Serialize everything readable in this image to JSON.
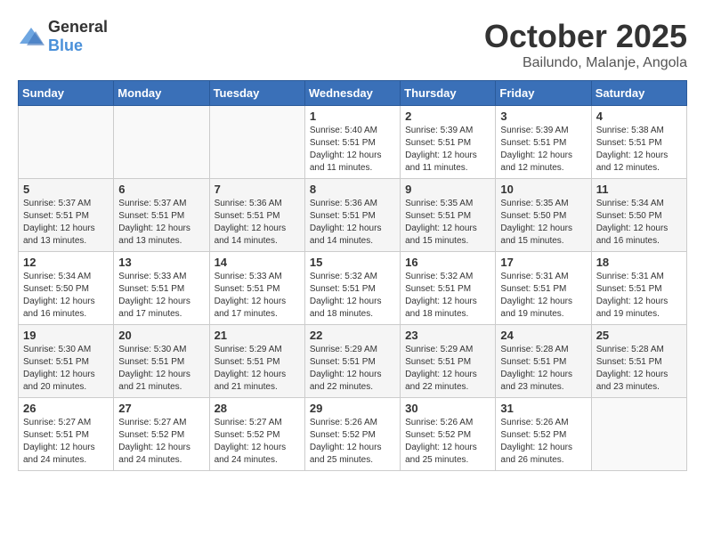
{
  "header": {
    "logo_general": "General",
    "logo_blue": "Blue",
    "title": "October 2025",
    "subtitle": "Bailundo, Malanje, Angola"
  },
  "days_of_week": [
    "Sunday",
    "Monday",
    "Tuesday",
    "Wednesday",
    "Thursday",
    "Friday",
    "Saturday"
  ],
  "weeks": [
    [
      {
        "day": "",
        "info": ""
      },
      {
        "day": "",
        "info": ""
      },
      {
        "day": "",
        "info": ""
      },
      {
        "day": "1",
        "info": "Sunrise: 5:40 AM\nSunset: 5:51 PM\nDaylight: 12 hours and 11 minutes."
      },
      {
        "day": "2",
        "info": "Sunrise: 5:39 AM\nSunset: 5:51 PM\nDaylight: 12 hours and 11 minutes."
      },
      {
        "day": "3",
        "info": "Sunrise: 5:39 AM\nSunset: 5:51 PM\nDaylight: 12 hours and 12 minutes."
      },
      {
        "day": "4",
        "info": "Sunrise: 5:38 AM\nSunset: 5:51 PM\nDaylight: 12 hours and 12 minutes."
      }
    ],
    [
      {
        "day": "5",
        "info": "Sunrise: 5:37 AM\nSunset: 5:51 PM\nDaylight: 12 hours and 13 minutes."
      },
      {
        "day": "6",
        "info": "Sunrise: 5:37 AM\nSunset: 5:51 PM\nDaylight: 12 hours and 13 minutes."
      },
      {
        "day": "7",
        "info": "Sunrise: 5:36 AM\nSunset: 5:51 PM\nDaylight: 12 hours and 14 minutes."
      },
      {
        "day": "8",
        "info": "Sunrise: 5:36 AM\nSunset: 5:51 PM\nDaylight: 12 hours and 14 minutes."
      },
      {
        "day": "9",
        "info": "Sunrise: 5:35 AM\nSunset: 5:51 PM\nDaylight: 12 hours and 15 minutes."
      },
      {
        "day": "10",
        "info": "Sunrise: 5:35 AM\nSunset: 5:50 PM\nDaylight: 12 hours and 15 minutes."
      },
      {
        "day": "11",
        "info": "Sunrise: 5:34 AM\nSunset: 5:50 PM\nDaylight: 12 hours and 16 minutes."
      }
    ],
    [
      {
        "day": "12",
        "info": "Sunrise: 5:34 AM\nSunset: 5:50 PM\nDaylight: 12 hours and 16 minutes."
      },
      {
        "day": "13",
        "info": "Sunrise: 5:33 AM\nSunset: 5:51 PM\nDaylight: 12 hours and 17 minutes."
      },
      {
        "day": "14",
        "info": "Sunrise: 5:33 AM\nSunset: 5:51 PM\nDaylight: 12 hours and 17 minutes."
      },
      {
        "day": "15",
        "info": "Sunrise: 5:32 AM\nSunset: 5:51 PM\nDaylight: 12 hours and 18 minutes."
      },
      {
        "day": "16",
        "info": "Sunrise: 5:32 AM\nSunset: 5:51 PM\nDaylight: 12 hours and 18 minutes."
      },
      {
        "day": "17",
        "info": "Sunrise: 5:31 AM\nSunset: 5:51 PM\nDaylight: 12 hours and 19 minutes."
      },
      {
        "day": "18",
        "info": "Sunrise: 5:31 AM\nSunset: 5:51 PM\nDaylight: 12 hours and 19 minutes."
      }
    ],
    [
      {
        "day": "19",
        "info": "Sunrise: 5:30 AM\nSunset: 5:51 PM\nDaylight: 12 hours and 20 minutes."
      },
      {
        "day": "20",
        "info": "Sunrise: 5:30 AM\nSunset: 5:51 PM\nDaylight: 12 hours and 21 minutes."
      },
      {
        "day": "21",
        "info": "Sunrise: 5:29 AM\nSunset: 5:51 PM\nDaylight: 12 hours and 21 minutes."
      },
      {
        "day": "22",
        "info": "Sunrise: 5:29 AM\nSunset: 5:51 PM\nDaylight: 12 hours and 22 minutes."
      },
      {
        "day": "23",
        "info": "Sunrise: 5:29 AM\nSunset: 5:51 PM\nDaylight: 12 hours and 22 minutes."
      },
      {
        "day": "24",
        "info": "Sunrise: 5:28 AM\nSunset: 5:51 PM\nDaylight: 12 hours and 23 minutes."
      },
      {
        "day": "25",
        "info": "Sunrise: 5:28 AM\nSunset: 5:51 PM\nDaylight: 12 hours and 23 minutes."
      }
    ],
    [
      {
        "day": "26",
        "info": "Sunrise: 5:27 AM\nSunset: 5:51 PM\nDaylight: 12 hours and 24 minutes."
      },
      {
        "day": "27",
        "info": "Sunrise: 5:27 AM\nSunset: 5:52 PM\nDaylight: 12 hours and 24 minutes."
      },
      {
        "day": "28",
        "info": "Sunrise: 5:27 AM\nSunset: 5:52 PM\nDaylight: 12 hours and 24 minutes."
      },
      {
        "day": "29",
        "info": "Sunrise: 5:26 AM\nSunset: 5:52 PM\nDaylight: 12 hours and 25 minutes."
      },
      {
        "day": "30",
        "info": "Sunrise: 5:26 AM\nSunset: 5:52 PM\nDaylight: 12 hours and 25 minutes."
      },
      {
        "day": "31",
        "info": "Sunrise: 5:26 AM\nSunset: 5:52 PM\nDaylight: 12 hours and 26 minutes."
      },
      {
        "day": "",
        "info": ""
      }
    ]
  ]
}
